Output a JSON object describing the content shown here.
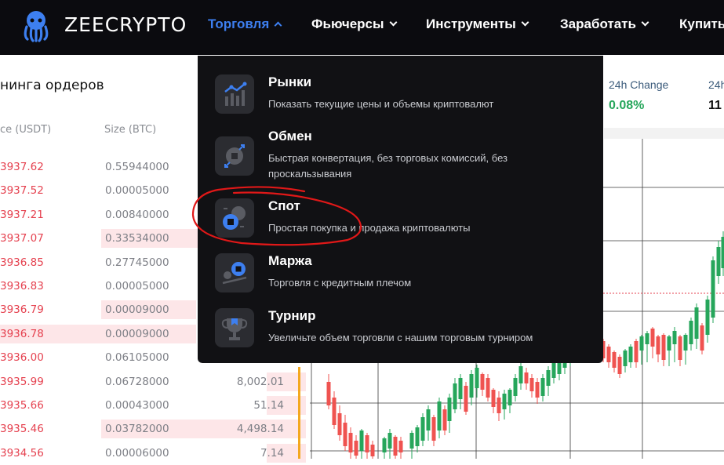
{
  "brand": {
    "name": "ZEECRYPTO",
    "logo_icon": "octopus-logo-icon"
  },
  "nav": [
    {
      "label": "Торговля",
      "active": true
    },
    {
      "label": "Фьючерсы",
      "active": false
    },
    {
      "label": "Инструменты",
      "active": false
    },
    {
      "label": "Заработать",
      "active": false
    },
    {
      "label": "Купить",
      "active": false
    }
  ],
  "orderbook": {
    "title": "нинга ордеров",
    "col_price": "ce (USDT)",
    "col_size": "Size (BTC)",
    "rows": [
      {
        "price": "3937.62",
        "size": "0.55944000",
        "total": ""
      },
      {
        "price": "3937.52",
        "size": "0.00005000",
        "total": ""
      },
      {
        "price": "3937.21",
        "size": "0.00840000",
        "total": ""
      },
      {
        "price": "3937.07",
        "size": "0.33534000",
        "total": ""
      },
      {
        "price": "3936.85",
        "size": "0.27745000",
        "total": ""
      },
      {
        "price": "3936.83",
        "size": "0.00005000",
        "total": ""
      },
      {
        "price": "3936.79",
        "size": "0.00009000",
        "total": ""
      },
      {
        "price": "3936.78",
        "size": "0.00009000",
        "total": ""
      },
      {
        "price": "3936.00",
        "size": "0.06105000",
        "total": ""
      },
      {
        "price": "3935.99",
        "size": "0.06728000",
        "total": "8,002.01"
      },
      {
        "price": "3935.66",
        "size": "0.00043000",
        "total": "51.14"
      },
      {
        "price": "3935.46",
        "size": "0.03782000",
        "total": "4,498.14"
      },
      {
        "price": "3934.56",
        "size": "0.00006000",
        "total": "7.14"
      }
    ]
  },
  "ticker": {
    "change_label": "24h Change",
    "change_value": "0.08%",
    "next_label": "24h",
    "next_value": "11"
  },
  "dropdown": {
    "items": [
      {
        "title": "Рынки",
        "desc": "Показать текущие цены и объемы криптовалют",
        "icon": "markets-chart-icon"
      },
      {
        "title": "Обмен",
        "desc": "Быстрая конвертация, без торговых комиссий, без проскальзывания",
        "icon": "exchange-icon"
      },
      {
        "title": "Спот",
        "desc": "Простая покупка и продажа криптовалюты",
        "icon": "spot-coin-icon"
      },
      {
        "title": "Маржа",
        "desc": "Торговля с кредитным плечом",
        "icon": "margin-scale-icon"
      },
      {
        "title": "Турнир",
        "desc": "Увеличьте объем торговли с нашим торговым турниром",
        "icon": "trophy-icon"
      }
    ]
  },
  "colors": {
    "accent": "#3d7ff0",
    "ask": "#e5414f",
    "bid": "#26a65b",
    "positive": "#26a65b"
  }
}
